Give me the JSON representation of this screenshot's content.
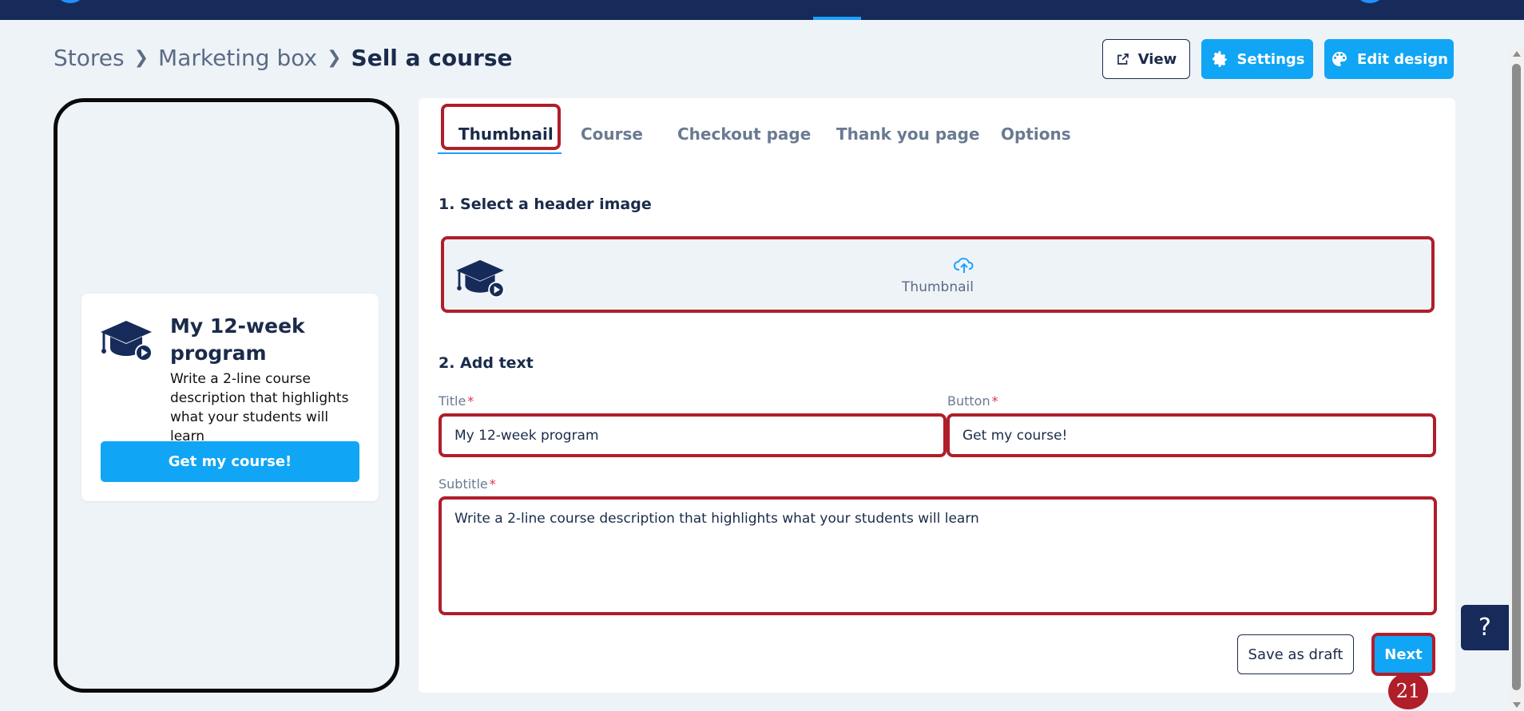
{
  "breadcrumb": [
    "Stores",
    "Marketing box",
    "Sell a course"
  ],
  "header": {
    "view_label": "View",
    "settings_label": "Settings",
    "edit_design_label": "Edit design"
  },
  "preview": {
    "title": "My 12-week program",
    "subtitle": "Write a 2-line course description that highlights what your students will learn",
    "button_label": "Get my course!"
  },
  "tabs": [
    "Thumbnail",
    "Course",
    "Checkout page",
    "Thank you page",
    "Options"
  ],
  "active_tab": "Thumbnail",
  "section1": {
    "title": "1. Select a header image",
    "upload_label": "Thumbnail"
  },
  "section2": {
    "title": "2. Add text",
    "title_label": "Title",
    "title_value": "My 12-week program",
    "button_label": "Button",
    "button_value": "Get my course!",
    "subtitle_label": "Subtitle",
    "subtitle_value": "Write a 2-line course description that highlights what your students will learn",
    "required_mark": "*"
  },
  "actions": {
    "save_draft_label": "Save as draft",
    "next_label": "Next"
  },
  "step_number": "21",
  "help_label": "?",
  "colors": {
    "accent": "#10a5f5",
    "navy": "#172b5a",
    "highlight": "#b01e2a"
  }
}
